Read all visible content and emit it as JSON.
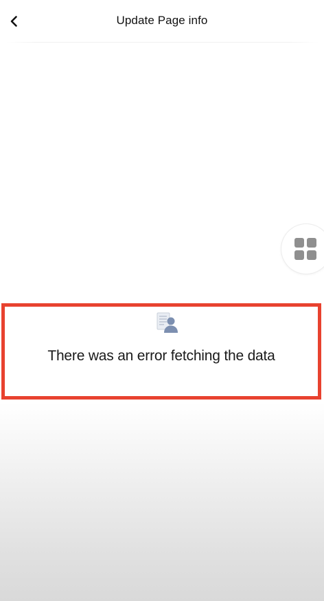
{
  "header": {
    "title": "Update Page info",
    "back_icon": "chevron-left-icon"
  },
  "floating_button": {
    "icon": "apps-grid-icon"
  },
  "error": {
    "icon": "document-person-icon",
    "message": "There was an error fetching the data",
    "highlight_color": "#e8422f"
  }
}
